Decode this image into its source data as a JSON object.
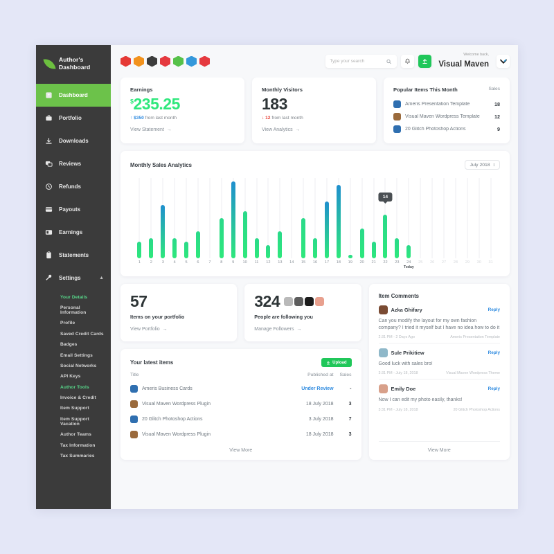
{
  "brand": {
    "line1": "Author's",
    "line2": "Dashboard",
    "logo_icon": "leaf-icon"
  },
  "sidebar": {
    "items": [
      {
        "label": "Dashboard",
        "icon": "dashboard-icon",
        "active": true
      },
      {
        "label": "Portfolio",
        "icon": "briefcase-icon",
        "active": false
      },
      {
        "label": "Downloads",
        "icon": "download-icon",
        "active": false
      },
      {
        "label": "Reviews",
        "icon": "chat-icon",
        "active": false
      },
      {
        "label": "Refunds",
        "icon": "refund-icon",
        "active": false
      },
      {
        "label": "Payouts",
        "icon": "card-icon",
        "active": false
      },
      {
        "label": "Earnings",
        "icon": "money-icon",
        "active": false
      },
      {
        "label": "Statements",
        "icon": "clipboard-icon",
        "active": false
      },
      {
        "label": "Settings",
        "icon": "wrench-icon",
        "active": false,
        "expanded": true
      }
    ],
    "settings_submenu": [
      {
        "label": "Your Details",
        "highlight": true
      },
      {
        "label": "Personal Information",
        "highlight": false
      },
      {
        "label": "Profile",
        "highlight": false
      },
      {
        "label": "Saved Credit Cards",
        "highlight": false
      },
      {
        "label": "Badges",
        "highlight": false
      },
      {
        "label": "Email Settings",
        "highlight": false
      },
      {
        "label": "Social Networks",
        "highlight": false
      },
      {
        "label": "API Keys",
        "highlight": false
      },
      {
        "label": "Author Tools",
        "highlight": true
      },
      {
        "label": "Invoice & Credit",
        "highlight": false
      },
      {
        "label": "Item Support",
        "highlight": false
      },
      {
        "label": "Item Support Vacation",
        "highlight": false
      },
      {
        "label": "Author Teams",
        "highlight": false
      },
      {
        "label": "Tax Information",
        "highlight": false
      },
      {
        "label": "Tax Summaries",
        "highlight": false
      }
    ]
  },
  "topbar": {
    "badges": [
      {
        "name": "badge-indonesia",
        "color": "#e53935"
      },
      {
        "name": "badge-bitcoin",
        "color": "#f2921d"
      },
      {
        "name": "badge-link",
        "color": "#3c3c3c"
      },
      {
        "name": "badge-award",
        "color": "#e5393f"
      },
      {
        "name": "badge-package",
        "color": "#56c149"
      },
      {
        "name": "badge-bolt",
        "color": "#3498db"
      },
      {
        "name": "badge-star",
        "color": "#e5393f"
      }
    ],
    "search_placeholder": "Type your search",
    "search_value": "",
    "notification_icon": "bell-icon",
    "upload_icon": "upload-icon",
    "welcome_label": "Welcome back,",
    "user_name": "Visual Maven"
  },
  "earnings": {
    "title": "Earnings",
    "currency": "$",
    "amount": "235.25",
    "delta_arrow": "↑",
    "delta_value": "$350",
    "delta_text": "from last month",
    "link": "View Statement",
    "arrow": "→",
    "color": "#2ee87c"
  },
  "visitors": {
    "title": "Monthly Visitors",
    "amount": "183",
    "delta_arrow": "↓",
    "delta_value": "12",
    "delta_text": "from last month",
    "link": "View Analytics",
    "arrow": "→"
  },
  "popular": {
    "title": "Popular Items This Month",
    "sales_header": "Sales",
    "rows": [
      {
        "name": "Ameris Presentation Template",
        "sales": "18",
        "color": "#2f6fb0"
      },
      {
        "name": "Visual Maven Wordpress Template",
        "sales": "12",
        "color": "#9a6a3c"
      },
      {
        "name": "20 Glitch Photoshop Actions",
        "sales": "9",
        "color": "#2f6fb0"
      }
    ]
  },
  "chart_data": {
    "type": "bar",
    "title": "Monthly Sales Analytics",
    "period_selector": "July 2018",
    "xlabel": "",
    "ylabel": "",
    "ylim": [
      0,
      24
    ],
    "grid": true,
    "today_label": "Today",
    "today_index": 24,
    "tooltip": {
      "day": 22,
      "value": "14"
    },
    "categories": [
      "1",
      "2",
      "3",
      "4",
      "5",
      "6",
      "7",
      "8",
      "9",
      "10",
      "11",
      "12",
      "13",
      "14",
      "15",
      "16",
      "17",
      "18",
      "19",
      "20",
      "21",
      "22",
      "23",
      "24",
      "25",
      "26",
      "27",
      "28",
      "29",
      "30",
      "31"
    ],
    "values": [
      5,
      6,
      16,
      6,
      5,
      8,
      0,
      12,
      23,
      14,
      6,
      4,
      8,
      0,
      12,
      6,
      17,
      22,
      1,
      9,
      5,
      13,
      6,
      4,
      0,
      0,
      0,
      0,
      0,
      0,
      0
    ],
    "bar_gradient_low": "#2ee87c",
    "bar_gradient_high": "#1f8fce"
  },
  "portfolio": {
    "count": "57",
    "caption": "Items on your portfolio",
    "link": "View Portfolio",
    "arrow": "→"
  },
  "followers": {
    "count": "324",
    "caption": "People are following you",
    "link": "Manage Followers",
    "arrow": "→",
    "avatars": [
      "#b9b9b9",
      "#5d5d5d",
      "#1b1b1b",
      "#e8a08e"
    ]
  },
  "latest": {
    "title": "Your latest items",
    "upload_label": "Upload",
    "columns": {
      "title": "Title",
      "published": "Published at",
      "sales": "Sales"
    },
    "rows": [
      {
        "name": "Ameris Business Cards",
        "published": "Under Review",
        "review": true,
        "sales": "-",
        "color": "#2f6fb0"
      },
      {
        "name": "Visual Maven Wordpress Plugin",
        "published": "18 July 2018",
        "review": false,
        "sales": "3",
        "color": "#9a6a3c"
      },
      {
        "name": "20 Glitch Photoshop Actions",
        "published": "3 July 2018",
        "review": false,
        "sales": "7",
        "color": "#2f6fb0"
      },
      {
        "name": "Visual Maven Wordpress Plugin",
        "published": "18 July 2018",
        "review": false,
        "sales": "3",
        "color": "#9a6a3c"
      }
    ],
    "view_more": "View More"
  },
  "comments": {
    "title": "Item Comments",
    "reply_label": "Reply",
    "view_more": "View More",
    "items": [
      {
        "author": "Azka Ghifary",
        "avatar_color": "#7a4b33",
        "text": "Can you modify the layout for my own fashion company? I tried it myself but I have no idea how to do it",
        "time": "2:31 PM - 2 Days Ago",
        "item": "Ameris Presentation Template"
      },
      {
        "author": "Sule Prikitiew",
        "avatar_color": "#8fb8c9",
        "text": "Good luck with sales bro!",
        "time": "3:31 PM - July 18, 2018",
        "item": "Visual Maven Wordpress Theme"
      },
      {
        "author": "Emily Doe",
        "avatar_color": "#d8a08a",
        "text": "Now I can edit my photo easily, thanks!",
        "time": "3:31 PM - July 18, 2018",
        "item": "20 Glitch Photoshop Actions"
      }
    ]
  }
}
